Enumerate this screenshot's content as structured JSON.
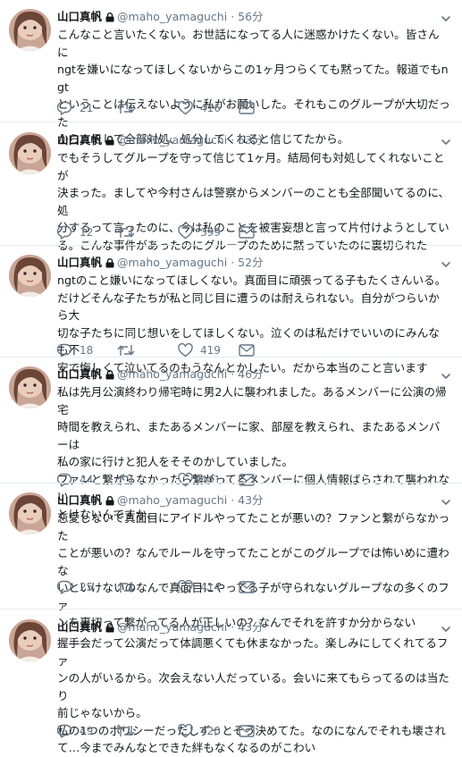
{
  "tweets": [
    {
      "name": "山口真帆",
      "handle": "@maho_yamaguchi",
      "dot": "·",
      "time": "56分",
      "text": "こんなこと言いたくない。お世話になってる人に迷惑かけたくない。皆さんに\nngtを嫌いになってほしくないからこの1ヶ月つらくても黙ってた。報道でもngt\nということは伝えないように私がお願いした。それもこのグループが大切だった\nから。そして全部対処、処分してくれると信じてたから。",
      "replies": "21",
      "retweets": "",
      "likes": "416"
    },
    {
      "name": "山口真帆",
      "handle": "@maho_yamaguchi",
      "dot": "·",
      "time": "53分",
      "text": "でもそうしてグループを守って信じて1ヶ月。結局何も対処してくれないことが\n決まった。ましてや今村さんは警察からメンバーのことも全部聞いてるのに、処\n分するって言ったのに、今は私のことを被害妄想と言って片付けようとしている。こんな事件があったのにグループのために黙っていたのに裏切られた",
      "replies": "12",
      "retweets": "",
      "likes": "399"
    },
    {
      "name": "山口真帆",
      "handle": "@maho_yamaguchi",
      "dot": "·",
      "time": "52分",
      "text": "ngtのこと嫌いになってほしくない。真面目に頑張ってる子もたくさんいる。\nだけどそんな子たちが私と同じ目に遭うのは耐えられない。自分がつらいから大\n切な子たちに同じ想いをしてほしくない。泣くのは私だけでいいのにみんなも不\n安で悔しくて泣いてるのもうなんとかしたい。だから本当のこと言います",
      "replies": "18",
      "retweets": "",
      "likes": "419"
    },
    {
      "name": "山口真帆",
      "handle": "@maho_yamaguchi",
      "dot": "·",
      "time": "46分",
      "text": "私は先月公演終わり帰宅時に男2人に襲われました。あるメンバーに公演の帰宅\n時間を教えられ、またあるメンバーに家、部屋を教えられ、またあるメンバーは\n私の家に行けと犯人をそそのかしていました。\nファンと繋がらなかったら繋がってるメンバーに個人情報ばらされて襲われない\nとけないんですか、",
      "replies": "44",
      "retweets": "",
      "likes": "441"
    },
    {
      "name": "山口真帆",
      "handle": "@maho_yamaguchi",
      "dot": "·",
      "time": "43分",
      "text": "恋愛しないで真面目にアイドルやってたことが悪いの？ファンと繋がらなかった\nことが悪いの？なんでルールを守ってたことがこのグループでは怖いめに遭わな\nいといけないのなんで真面目にやってる子が守られないグループなの多くのファ\nンを裏切って繋がってる人が正しいの？なんでそれを許すか分からない",
      "replies": "25",
      "retweets": "",
      "likes": "414"
    },
    {
      "name": "山口真帆",
      "handle": "@maho_yamaguchi",
      "dot": "·",
      "time": "43分",
      "text": "握手会だって公演だって体調悪くても休まなかった。楽しみにしてくれてるファ\nンの人がいるから。次会えない人だっている。会いに来てもらってるのは当たり\n前じゃないから。\n私の1つのポリシーだったしずっとそう決めてた。なのになんでそれも壊されて…今までみんなとできた絆もなくなるのがこわい",
      "replies": "49",
      "retweets": "",
      "likes": "420"
    }
  ]
}
